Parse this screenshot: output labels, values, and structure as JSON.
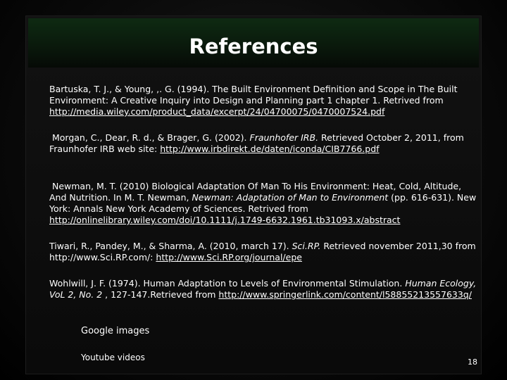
{
  "title": "References",
  "refs": {
    "r1": {
      "text": "Bartuska, T. J., & Young, ,. G. (1994). The Built Environment Definition and Scope in The Built Environment: A Creative Inquiry into Design and Planning part 1 chapter 1. Retrived from ",
      "link": "http://media.wiley.com/product_data/excerpt/24/04700075/0470007524.pdf"
    },
    "r2": {
      "pre": "Morgan, C., Dear, R. d., & Brager, G. (2002). ",
      "ital": "Fraunhofer IRB.",
      "mid": " Retrieved October 2, 2011, from Fraunhofer IRB web site: ",
      "link": "http://www.irbdirekt.de/daten/iconda/CIB7766.pdf"
    },
    "r3": {
      "pre": "Newman, M. T. (2010) Biological Adaptation Of Man To His Environment: Heat, Cold, Altitude, And Nutrition. In M. T. Newman, ",
      "ital": "Newman: Adaptation of Man to Environment",
      "mid": " (pp. 616-631). New York: Annals New York Academy of Sciences. Retrived from ",
      "link": "http://onlinelibrary.wiley.com/doi/10.1111/j.1749-6632.1961.tb31093.x/abstract"
    },
    "r4": {
      "pre": "Tiwari, R., Pandey, M., & Sharma, A. (2010, march 17). ",
      "ital": "Sci.RP.",
      "mid": "  Retrieved november 2011,30 from http://www.Sci.RP.com/: ",
      "link": "http://www.Sci.RP.org/journal/epe"
    },
    "r5": {
      "pre": "Wohlwill, J. F. (1974). Human Adaptation to Levels of Environmental Stimulation. ",
      "ital": "Human Ecology, VoL 2, No. 2",
      "mid": " , 127-147.Retrieved from ",
      "link": "http://www.springerlink.com/content/l58855213557633q/"
    }
  },
  "extras": {
    "google": "Google images",
    "youtube": "Youtube videos"
  },
  "page_number": "18"
}
